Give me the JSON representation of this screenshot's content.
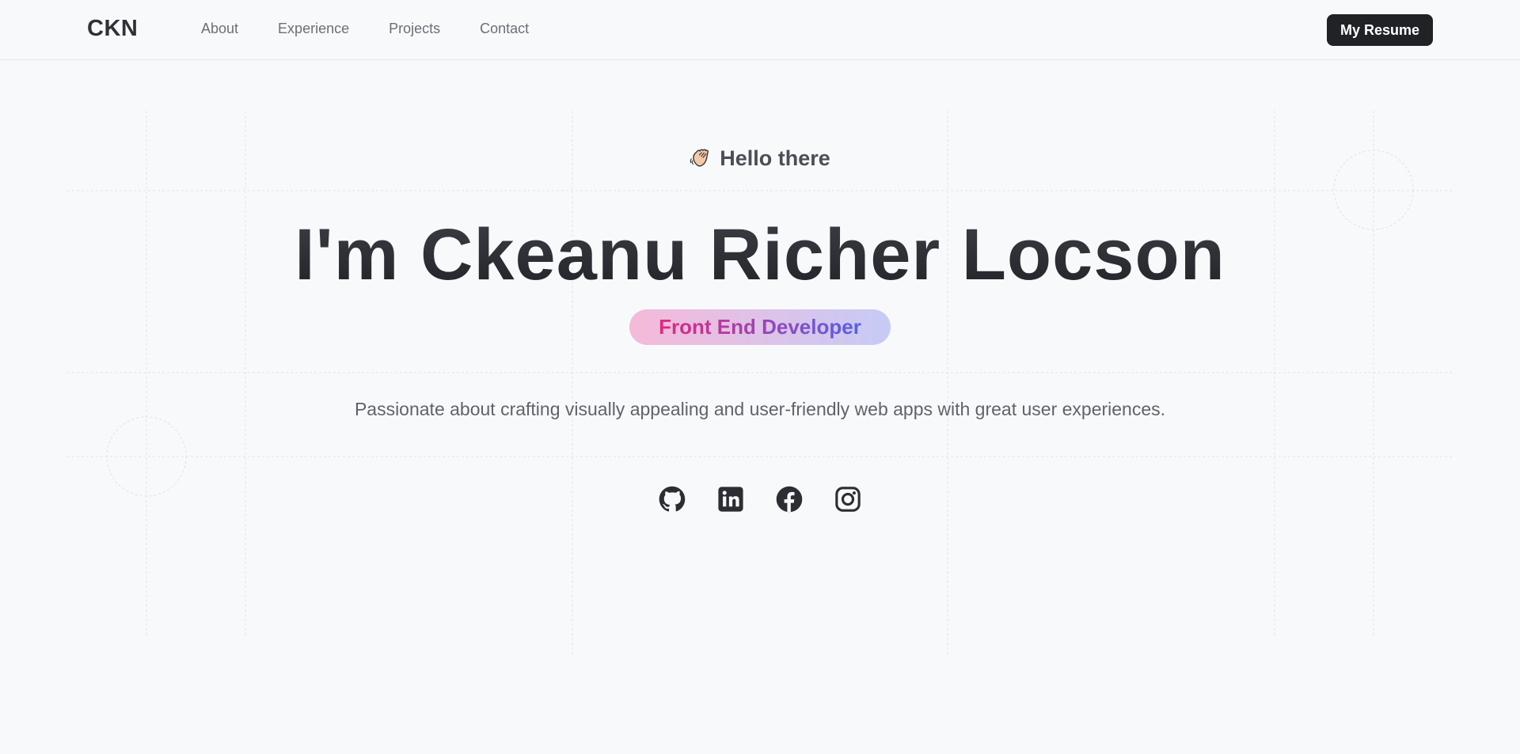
{
  "nav": {
    "logo": "CKN",
    "links": [
      "About",
      "Experience",
      "Projects",
      "Contact"
    ],
    "resume_label": "My Resume"
  },
  "hero": {
    "greeting_icon": "waving-hand-icon",
    "greeting": "Hello there",
    "name": "I'm Ckeanu Richer Locson",
    "role": "Front End Developer",
    "tagline": "Passionate about crafting visually appealing and user-friendly web apps with great user experiences."
  },
  "socials": [
    {
      "icon": "github-icon"
    },
    {
      "icon": "linkedin-icon"
    },
    {
      "icon": "facebook-icon"
    },
    {
      "icon": "instagram-icon"
    }
  ],
  "colors": {
    "background": "#f8f9fb",
    "text_dark": "#2b2e33",
    "button_bg": "#202226",
    "role_gradient_start": "#e0287c",
    "role_gradient_end": "#5561e8"
  }
}
